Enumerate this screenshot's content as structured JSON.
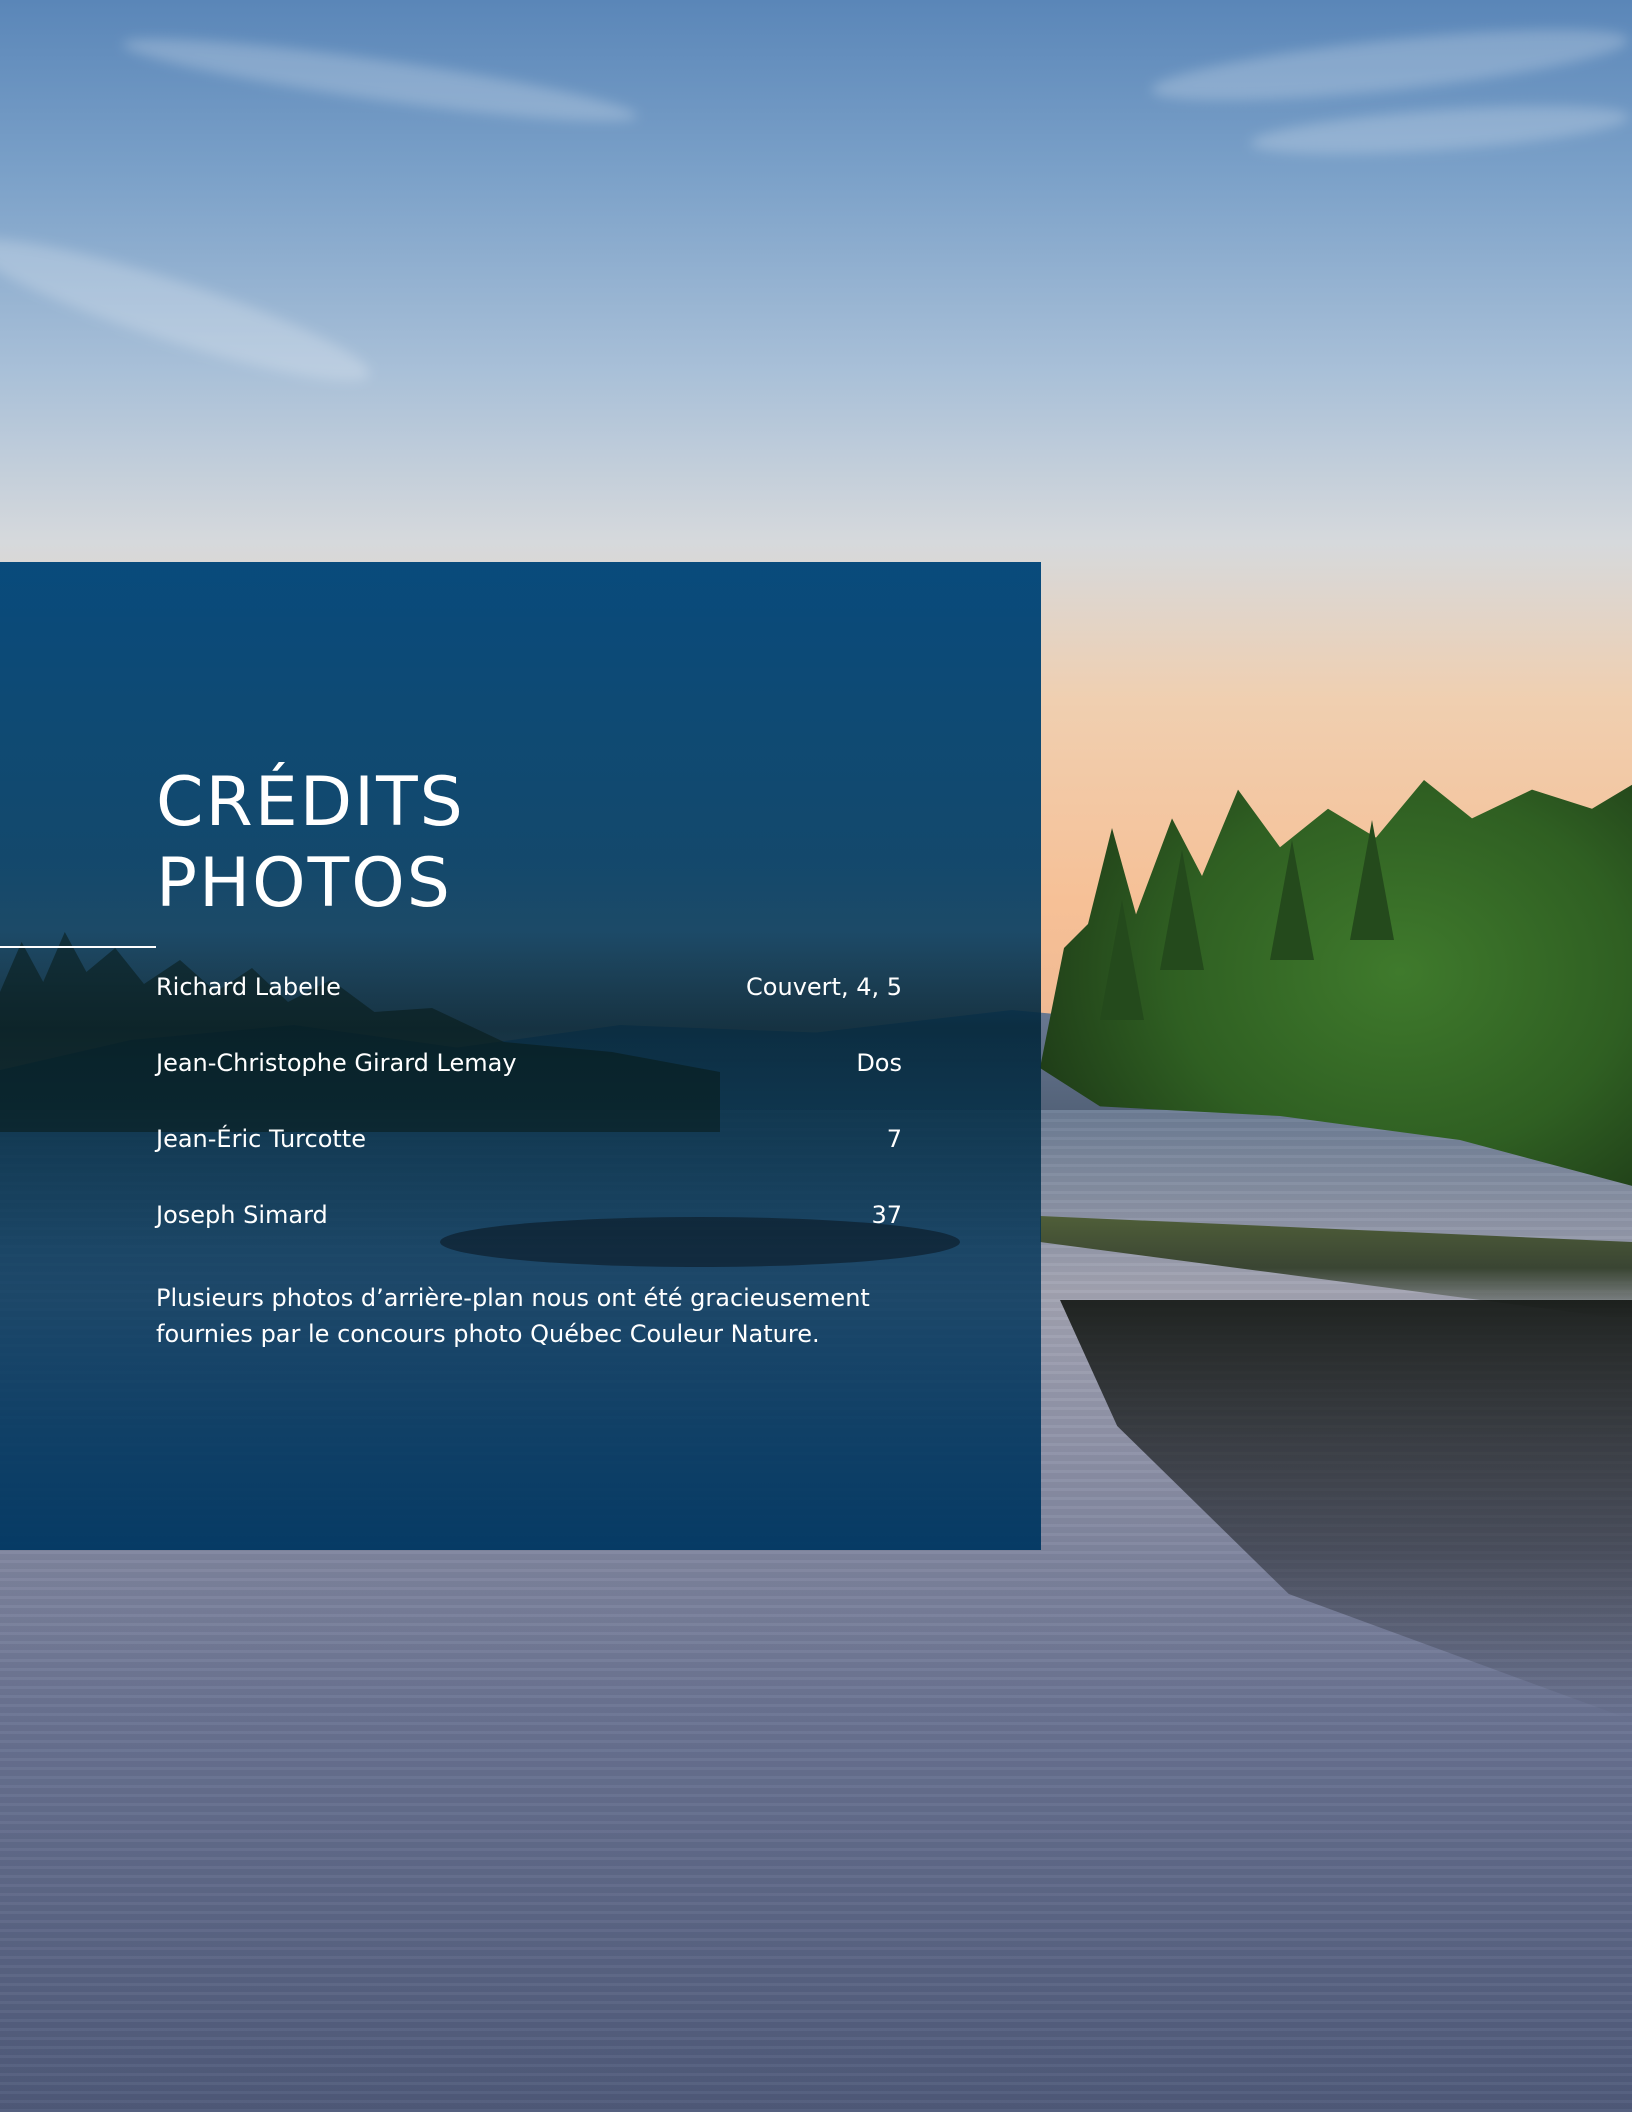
{
  "page": {
    "title": "CRÉDITS\nPHOTOS",
    "credits": [
      {
        "name": "Richard Labelle",
        "pages": "Couvert, 4, 5"
      },
      {
        "name": "Jean-Christophe Girard Lemay",
        "pages": "Dos"
      },
      {
        "name": "Jean-Éric Turcotte",
        "pages": "7"
      },
      {
        "name": "Joseph Simard",
        "pages": "37"
      }
    ],
    "note": "Plusieurs photos d’arrière-plan nous ont été gracieusement fournies par le concours photo Québec Couleur Nature."
  },
  "colors": {
    "panel": "#004070",
    "text": "#ffffff",
    "sky_top": "#5a86b8",
    "sunset": "#f6c096"
  }
}
